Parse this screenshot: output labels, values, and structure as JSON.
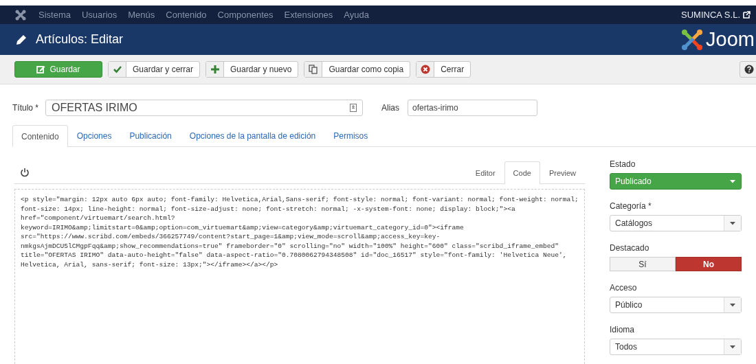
{
  "top_menu": {
    "items": [
      "Sistema",
      "Usuarios",
      "Menús",
      "Contenido",
      "Componentes",
      "Extensiones",
      "Ayuda"
    ],
    "site": "SUMINCA S.L."
  },
  "header": {
    "title": "Artículos: Editar",
    "logo_text": "Joom"
  },
  "toolbar": {
    "buttons": [
      {
        "label": "Guardar",
        "kind": "primary"
      },
      {
        "label": "Guardar y cerrar",
        "kind": "check"
      },
      {
        "label": "Guardar y nuevo",
        "kind": "plus"
      },
      {
        "label": "Guardar como copia",
        "kind": "copy"
      },
      {
        "label": "Cerrar",
        "kind": "close"
      }
    ]
  },
  "form": {
    "title_label": "Título *",
    "title_value": "OFERTAS IRIMO",
    "alias_label": "Alias",
    "alias_value": "ofertas-irimo"
  },
  "tabs": [
    {
      "label": "Contenido",
      "selected": true
    },
    {
      "label": "Opciones",
      "selected": false
    },
    {
      "label": "Publicación",
      "selected": false
    },
    {
      "label": "Opciones de la pantalla de edición",
      "selected": false
    },
    {
      "label": "Permisos",
      "selected": false
    }
  ],
  "editor": {
    "modes": [
      {
        "label": "Editor",
        "selected": false
      },
      {
        "label": "Code",
        "selected": true
      },
      {
        "label": "Preview",
        "selected": false
      }
    ],
    "code_lines": [
      "<p style=\"margin: 12px auto 6px auto; font-family: Helvetica,Arial,Sans-serif; font-style: normal; font-variant: normal; font-weight: normal;",
      "font-size: 14px; line-height: normal; font-size-adjust: none; font-stretch: normal; -x-system-font: none; display: block;\"><a",
      "href=\"component/virtuemart/search.html?",
      "keyword=IRIMO&amp;limitstart=0&amp;option=com_virtuemart&amp;view=category&amp;virtuemart_category_id=0\"><iframe",
      "src=\"https://www.scribd.com/embeds/366257749/content?start_page=1&amp;view_mode=scroll&amp;access_key=key-",
      "nmkgsAjmDCU5lCMgpFqq&amp;show_recommendations=true\" frameborder=\"0\" scrolling=\"no\" width=\"100%\" height=\"600\" class=\"scribd_iframe_embed\"",
      "title=\"OFERTAS IRIMO\" data-auto-height=\"false\" data-aspect-ratio=\"0.7080062794348508\" id=\"doc_16517\" style=\"font-family: 'Helvetica Neue',",
      "Helvetica, Arial, sans-serif; font-size: 13px;\"></iframe></a></p>"
    ]
  },
  "sidebar": {
    "fields": [
      {
        "kind": "status",
        "label": "Estado",
        "value": "Publicado"
      },
      {
        "kind": "select",
        "label": "Categoría *",
        "value": "Catálogos"
      },
      {
        "kind": "toggle",
        "label": "Destacado",
        "options": [
          {
            "label": "Sí",
            "selected": false
          },
          {
            "label": "No",
            "selected": true
          }
        ]
      },
      {
        "kind": "select",
        "label": "Acceso",
        "value": "Público"
      },
      {
        "kind": "select",
        "label": "Idioma",
        "value": "Todos"
      }
    ]
  }
}
